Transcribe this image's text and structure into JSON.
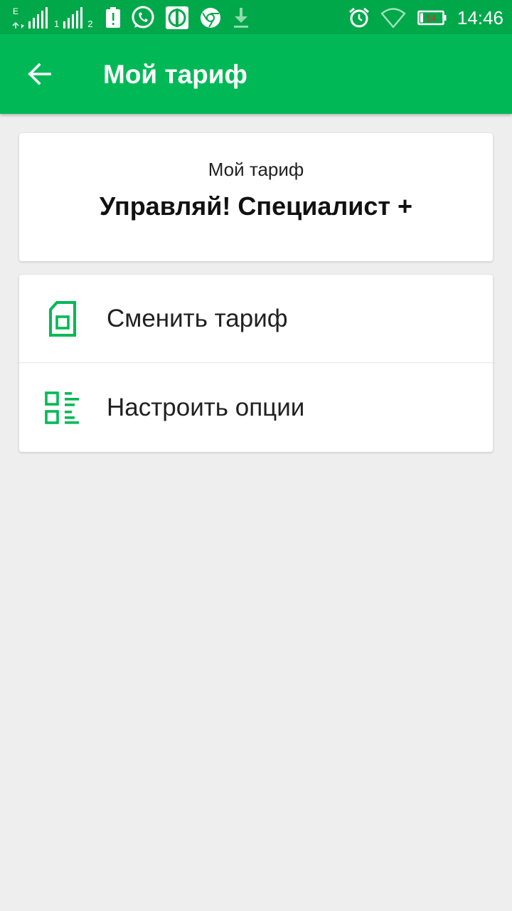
{
  "status_bar": {
    "sim1_network": "E",
    "sim1_label": "1",
    "sim2_label": "2",
    "battery_level": "14",
    "time": "14:46",
    "icons": [
      "signal-icon",
      "battery-alert-icon",
      "whatsapp-icon",
      "app-icon",
      "chrome-icon",
      "download-icon",
      "alarm-icon",
      "wifi-icon",
      "battery-icon"
    ]
  },
  "app_bar": {
    "title": "Мой тариф",
    "back_icon": "arrow-back-icon"
  },
  "tariff": {
    "label": "Мой тариф",
    "name": "Управляй! Специалист +"
  },
  "menu": {
    "items": [
      {
        "label": "Сменить тариф",
        "icon": "sim-card-icon"
      },
      {
        "label": "Настроить опции",
        "icon": "options-list-icon"
      }
    ]
  },
  "colors": {
    "status_bar": "#00a84a",
    "app_bar": "#00b956",
    "accent": "#00b956",
    "background": "#eeeeee"
  }
}
